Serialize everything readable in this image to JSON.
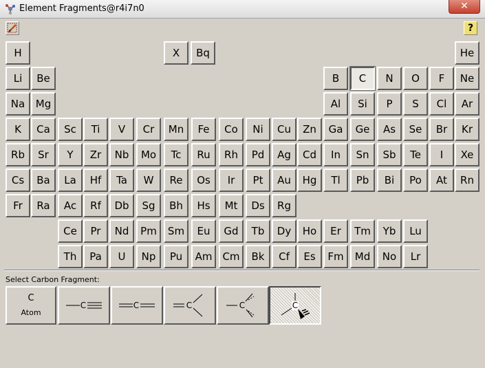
{
  "window": {
    "title": "Element Fragments@r4i7n0",
    "close_glyph": "✕"
  },
  "toolbar": {
    "tool_icon": "pen-eraser-icon",
    "help_label": "?"
  },
  "rows": [
    [
      "H",
      "X",
      "Bq",
      "He"
    ],
    [
      "Li",
      "Be",
      "B",
      "C",
      "N",
      "O",
      "F",
      "Ne"
    ],
    [
      "Na",
      "Mg",
      "Al",
      "Si",
      "P",
      "S",
      "Cl",
      "Ar"
    ],
    [
      "K",
      "Ca",
      "Sc",
      "Ti",
      "V",
      "Cr",
      "Mn",
      "Fe",
      "Co",
      "Ni",
      "Cu",
      "Zn",
      "Ga",
      "Ge",
      "As",
      "Se",
      "Br",
      "Kr"
    ],
    [
      "Rb",
      "Sr",
      "Y",
      "Zr",
      "Nb",
      "Mo",
      "Tc",
      "Ru",
      "Rh",
      "Pd",
      "Ag",
      "Cd",
      "In",
      "Sn",
      "Sb",
      "Te",
      "I",
      "Xe"
    ],
    [
      "Cs",
      "Ba",
      "La",
      "Hf",
      "Ta",
      "W",
      "Re",
      "Os",
      "Ir",
      "Pt",
      "Au",
      "Hg",
      "Tl",
      "Pb",
      "Bi",
      "Po",
      "At",
      "Rn"
    ],
    [
      "Fr",
      "Ra",
      "Ac",
      "Rf",
      "Db",
      "Sg",
      "Bh",
      "Hs",
      "Mt",
      "Ds",
      "Rg"
    ],
    [
      "Ce",
      "Pr",
      "Nd",
      "Pm",
      "Sm",
      "Eu",
      "Gd",
      "Tb",
      "Dy",
      "Ho",
      "Er",
      "Tm",
      "Yb",
      "Lu"
    ],
    [
      "Th",
      "Pa",
      "U",
      "Np",
      "Pu",
      "Am",
      "Cm",
      "Bk",
      "Cf",
      "Es",
      "Fm",
      "Md",
      "No",
      "Lr"
    ]
  ],
  "selected_element": "C",
  "fragments": {
    "label": "Select Carbon Fragment:",
    "atom": {
      "symbol": "C",
      "caption": "Atom"
    },
    "carbon_letter": "C",
    "items": [
      "atom",
      "sp-triple",
      "sp-double",
      "sp2-trigonal",
      "sp3-tetrahedral",
      "sp3-wedge"
    ],
    "selected": "sp3-wedge"
  }
}
